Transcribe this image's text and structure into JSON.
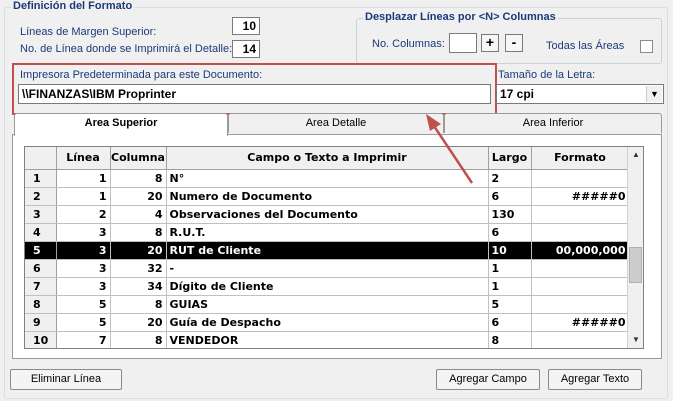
{
  "format_group": {
    "title": "Definición del Formato",
    "margin_lines_label": "Líneas de Margen Superior:",
    "margin_lines_value": "10",
    "detail_line_label": "No. de Línea donde se Imprimirá el Detalle:",
    "detail_line_value": "14"
  },
  "shift_group": {
    "title": "Desplazar Líneas por <N> Columnas",
    "columns_label": "No. Columnas:",
    "columns_value": "",
    "plus_label": "+",
    "minus_label": "-",
    "all_areas_label": "Todas las Áreas"
  },
  "printer": {
    "label": "Impresora Predeterminada para este Documento:",
    "value": "\\\\FINANZAS\\IBM Proprinter"
  },
  "font_size": {
    "label": "Tamaño de la Letra:",
    "value": "17 cpi"
  },
  "tabs": [
    {
      "label": "Area Superior"
    },
    {
      "label": "Area Detalle"
    },
    {
      "label": "Area Inferior"
    }
  ],
  "grid": {
    "headers": [
      "",
      "Línea",
      "Columna",
      "Campo o Texto a Imprimir",
      "Largo",
      "Formato"
    ],
    "rows": [
      {
        "n": "1",
        "linea": "1",
        "columna": "8",
        "campo": "N°",
        "largo": "2",
        "formato": ""
      },
      {
        "n": "2",
        "linea": "1",
        "columna": "20",
        "campo": "Numero de Documento",
        "largo": "6",
        "formato": "#####0"
      },
      {
        "n": "3",
        "linea": "2",
        "columna": "4",
        "campo": "Observaciones del Documento",
        "largo": "130",
        "formato": ""
      },
      {
        "n": "4",
        "linea": "3",
        "columna": "8",
        "campo": "R.U.T.",
        "largo": "6",
        "formato": ""
      },
      {
        "n": "5",
        "linea": "3",
        "columna": "20",
        "campo": "RUT de Cliente",
        "largo": "10",
        "formato": "00,000,000"
      },
      {
        "n": "6",
        "linea": "3",
        "columna": "32",
        "campo": "-",
        "largo": "1",
        "formato": ""
      },
      {
        "n": "7",
        "linea": "3",
        "columna": "34",
        "campo": "Dígito de Cliente",
        "largo": "1",
        "formato": ""
      },
      {
        "n": "8",
        "linea": "5",
        "columna": "8",
        "campo": "GUIAS",
        "largo": "5",
        "formato": ""
      },
      {
        "n": "9",
        "linea": "5",
        "columna": "20",
        "campo": "Guía de Despacho",
        "largo": "6",
        "formato": "#####0"
      },
      {
        "n": "10",
        "linea": "7",
        "columna": "8",
        "campo": "VENDEDOR",
        "largo": "8",
        "formato": ""
      }
    ],
    "selected_row": 4
  },
  "buttons": {
    "delete_line": "Eliminar Línea",
    "add_field": "Agregar Campo",
    "add_text": "Agregar Texto"
  },
  "colors": {
    "label_blue": "#1a3a7a",
    "highlight_red": "#c0504d"
  }
}
